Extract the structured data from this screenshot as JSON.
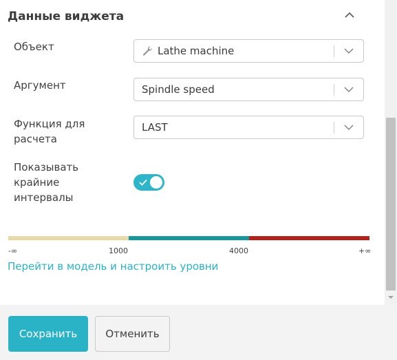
{
  "section": {
    "title": "Данные виджета"
  },
  "fields": {
    "object": {
      "label": "Объект",
      "value": "Lathe machine",
      "icon": "wrench-icon"
    },
    "argument": {
      "label": "Аргумент",
      "value": "Spindle speed"
    },
    "function": {
      "label_line1": "Функция для",
      "label_line2": "расчета",
      "value": "LAST"
    },
    "show_extreme": {
      "label_line1": "Показывать",
      "label_line2": "крайние",
      "label_line3": "интервалы",
      "enabled": true
    }
  },
  "levels": {
    "segments": [
      {
        "color": "#e8d9a8"
      },
      {
        "color": "#17979a"
      },
      {
        "color": "#b0231b"
      }
    ],
    "ticks": [
      "-∞",
      "1000",
      "4000",
      "+∞"
    ],
    "link": "Перейти в модель и настроить уровни"
  },
  "footer": {
    "save_label": "Сохранить",
    "cancel_label": "Отменить"
  }
}
